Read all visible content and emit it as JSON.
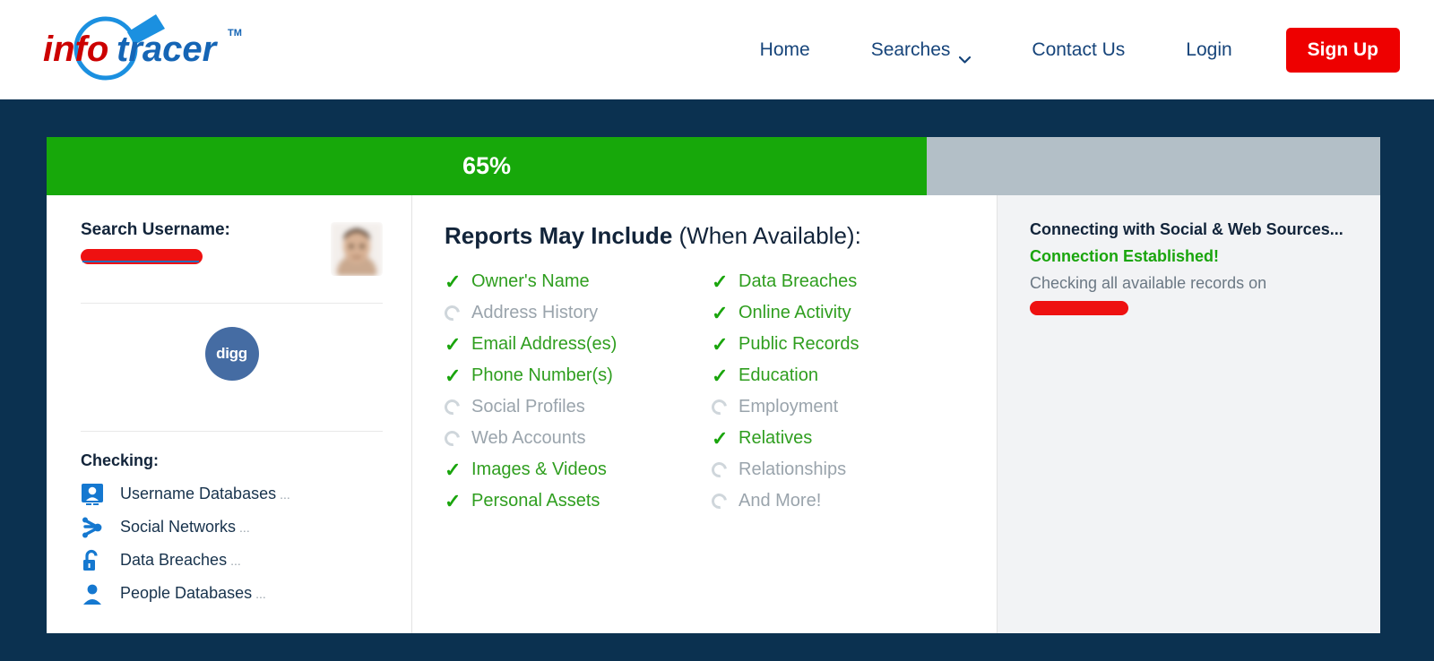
{
  "header": {
    "logo": {
      "name": "infotracer",
      "part1": "info",
      "part2": "tracer",
      "tm": "TM"
    },
    "nav": [
      {
        "label": "Home",
        "name": "nav-home"
      },
      {
        "label": "Searches",
        "name": "nav-searches",
        "has_chevron": true
      },
      {
        "label": "Contact Us",
        "name": "nav-contact-us"
      },
      {
        "label": "Login",
        "name": "nav-login"
      }
    ],
    "signup_label": "Sign Up"
  },
  "progress": {
    "percent_label": "65%",
    "percent_value": 66,
    "fill_color": "#17a80a",
    "track_color": "#b3bfc7"
  },
  "left_panel": {
    "search_label": "Search Username:",
    "username_value": "",
    "username_redacted": true,
    "avatar_name": "user-avatar",
    "social_badge": {
      "label": "digg",
      "color": "#456ca3"
    },
    "checking_title": "Checking:",
    "checking_items": [
      {
        "label": "Username Databases",
        "suffix": "...",
        "icon": "id-card-icon"
      },
      {
        "label": "Social Networks",
        "suffix": "...",
        "icon": "share-network-icon"
      },
      {
        "label": "Data Breaches",
        "suffix": "...",
        "icon": "open-padlock-icon"
      },
      {
        "label": "People Databases",
        "suffix": "...",
        "icon": "person-icon"
      }
    ]
  },
  "center_panel": {
    "heading_bold": "Reports May Include",
    "heading_rest": " (When Available):",
    "column_left": [
      {
        "label": "Owner's Name",
        "state": "done"
      },
      {
        "label": "Address History",
        "state": "pending"
      },
      {
        "label": "Email Address(es)",
        "state": "done"
      },
      {
        "label": "Phone Number(s)",
        "state": "done"
      },
      {
        "label": "Social Profiles",
        "state": "pending"
      },
      {
        "label": "Web Accounts",
        "state": "pending"
      },
      {
        "label": "Images & Videos",
        "state": "done"
      },
      {
        "label": "Personal Assets",
        "state": "done"
      }
    ],
    "column_right": [
      {
        "label": "Data Breaches",
        "state": "done"
      },
      {
        "label": "Online Activity",
        "state": "done"
      },
      {
        "label": "Public Records",
        "state": "done"
      },
      {
        "label": "Education",
        "state": "done"
      },
      {
        "label": "Employment",
        "state": "pending"
      },
      {
        "label": "Relatives",
        "state": "done"
      },
      {
        "label": "Relationships",
        "state": "pending"
      },
      {
        "label": "And More!",
        "state": "pending"
      }
    ]
  },
  "right_panel": {
    "connecting_text": "Connecting with Social & Web Sources...",
    "established_text": "Connection Established!",
    "checking_text": "Checking all available records on",
    "target_redacted": true
  },
  "colors": {
    "page_background": "#0b3150",
    "accent_red": "#ee0000",
    "accent_green": "#1aa50d",
    "nav_text": "#16447a",
    "panel_gray": "#f2f3f5"
  }
}
